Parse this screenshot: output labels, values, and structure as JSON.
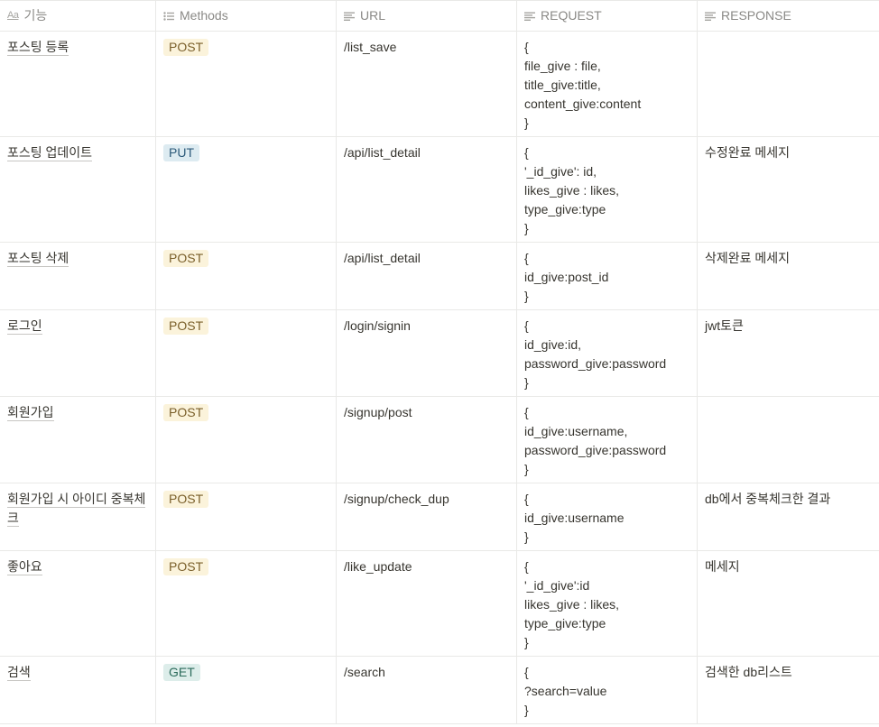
{
  "header": {
    "col1": "기능",
    "col2": "Methods",
    "col3": "URL",
    "col4": "REQUEST",
    "col5": "RESPONSE",
    "col1_icon": "Aa"
  },
  "colors": {
    "post_bg": "#fbf3db",
    "put_bg": "#ddebf1",
    "get_bg": "#ddedea"
  },
  "rows": [
    {
      "name": "포스팅 등록",
      "method": "POST",
      "url": "/list_save",
      "request": "{\nfile_give : file,\ntitle_give:title,\ncontent_give:content\n}",
      "response": ""
    },
    {
      "name": "포스팅 업데이트",
      "method": "PUT",
      "url": "/api/list_detail",
      "request": "{\n'_id_give': id,\nlikes_give : likes,\ntype_give:type\n}",
      "response": "수정완료 메세지"
    },
    {
      "name": "포스팅 삭제",
      "method": "POST",
      "url": "/api/list_detail",
      "request": "{\nid_give:post_id\n}",
      "response": "삭제완료 메세지"
    },
    {
      "name": "로그인",
      "method": "POST",
      "url": "/login/signin",
      "request": "{\nid_give:id,\npassword_give:password\n}",
      "response": "jwt토큰"
    },
    {
      "name": "회원가입",
      "method": "POST",
      "url": "/signup/post",
      "request": "{\nid_give:username,\npassword_give:password\n}",
      "response": ""
    },
    {
      "name": "회원가입 시 아이디 중복체크",
      "method": "POST",
      "url": "/signup/check_dup",
      "request": "{\nid_give:username\n}",
      "response": "db에서 중복체크한 결과"
    },
    {
      "name": "좋아요",
      "method": "POST",
      "url": "/like_update",
      "request": "{\n'_id_give':id\nlikes_give : likes,\ntype_give:type\n}",
      "response": "메세지"
    },
    {
      "name": "검색",
      "method": "GET",
      "url": "/search",
      "request": "{\n?search=value\n}",
      "response": "검색한 db리스트"
    }
  ]
}
